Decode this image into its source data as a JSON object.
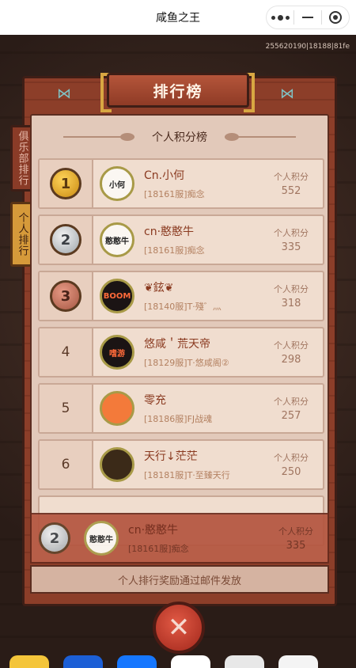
{
  "app": {
    "title": "咸鱼之王"
  },
  "serial": "255620190|18188|81fe",
  "panel": {
    "title": "排行榜",
    "subtitle": "个人积分榜",
    "footer": "个人排行奖励通过邮件发放"
  },
  "tabs": {
    "club": "俱乐部排行",
    "personal": "个人排行"
  },
  "score_label": "个人积分",
  "rows": [
    {
      "rank": "1",
      "medal": "gold",
      "avatar": "小何",
      "name": "Cn.小何",
      "server": "[18161服]痴念",
      "score": "552"
    },
    {
      "rank": "2",
      "medal": "silver",
      "avatar": "憨憨牛",
      "name": "cn·憨憨牛",
      "server": "[18161服]痴念",
      "score": "335"
    },
    {
      "rank": "3",
      "medal": "bronze",
      "avatar": "BOOM",
      "name": "❦鉉❦",
      "server": "[18140服]T·殘゛灬",
      "score": "318"
    },
    {
      "rank": "4",
      "medal": "",
      "avatar": "嗜游",
      "name": "悠咸＇荒天帝",
      "server": "[18129服]T·悠咸阁②",
      "score": "298"
    },
    {
      "rank": "5",
      "medal": "",
      "avatar": "",
      "name": "零充",
      "server": "[18186服]FJ战魂",
      "score": "257"
    },
    {
      "rank": "6",
      "medal": "",
      "avatar": "",
      "name": "天行↓茫茫",
      "server": "[18181服]T·至臻天行",
      "score": "250"
    }
  ],
  "me": {
    "rank": "2",
    "avatar": "憨憨牛",
    "name": "cn·憨憨牛",
    "server": "[18161服]痴念",
    "score": "335"
  },
  "icons": {
    "close": "close-icon",
    "more": "more-icon",
    "minimize": "minimize-icon",
    "target": "target-icon"
  }
}
